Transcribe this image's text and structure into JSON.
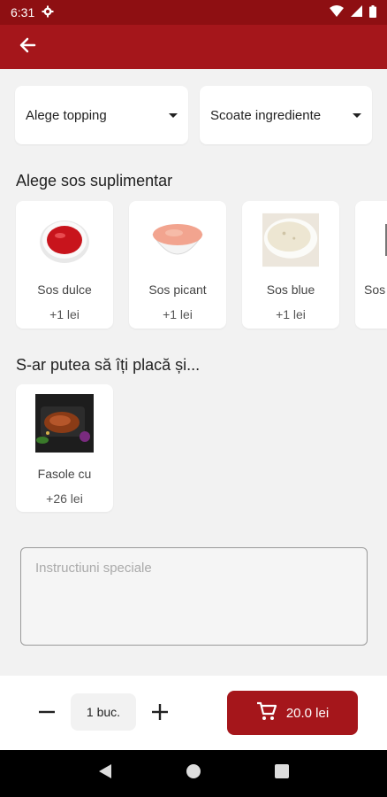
{
  "status_bar": {
    "time": "6:31"
  },
  "options": {
    "topping_label": "Alege topping",
    "remove_label": "Scoate ingrediente"
  },
  "sauces": {
    "title": "Alege sos suplimentar",
    "items": [
      {
        "name": "Sos dulce",
        "price": "+1 lei"
      },
      {
        "name": "Sos picant",
        "price": "+1 lei"
      },
      {
        "name": "Sos blue",
        "price": "+1 lei"
      },
      {
        "name": "Sos"
      }
    ]
  },
  "suggestions": {
    "title": "S-ar putea să îți placă și...",
    "items": [
      {
        "name": "Fasole cu",
        "price": "+26 lei"
      }
    ]
  },
  "instructions": {
    "placeholder": "Instructiuni speciale"
  },
  "footer": {
    "quantity": "1 buc.",
    "cart_total": "20.0 lei"
  },
  "colors": {
    "brand": "#a5161b",
    "status_bar": "#8e0f12"
  }
}
